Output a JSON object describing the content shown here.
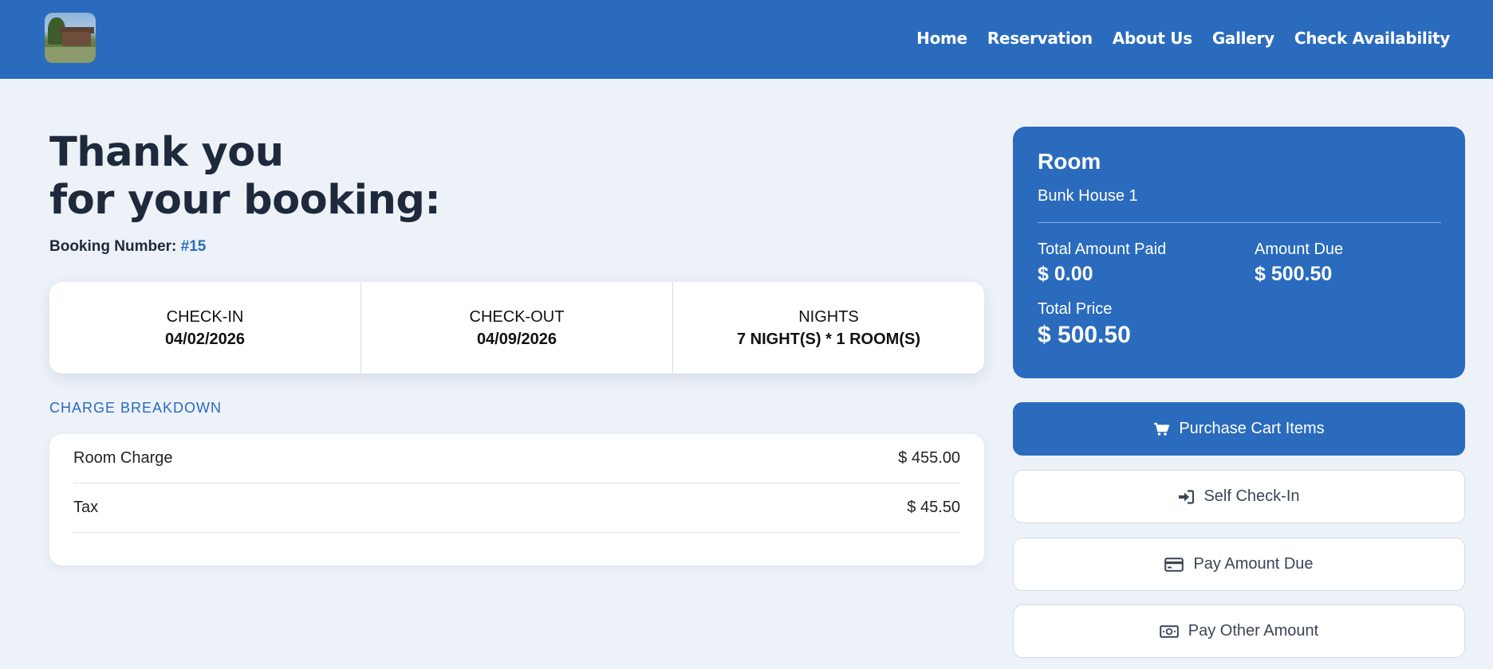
{
  "header": {
    "nav": [
      "Home",
      "Reservation",
      "About Us",
      "Gallery",
      "Check Availability"
    ]
  },
  "main": {
    "title_line1": "Thank you",
    "title_line2": "for your booking:",
    "booking_label": "Booking Number:",
    "booking_number": "#15",
    "stay": {
      "checkin_label": "CHECK-IN",
      "checkin_value": "04/02/2026",
      "checkout_label": "CHECK-OUT",
      "checkout_value": "04/09/2026",
      "nights_label": "NIGHTS",
      "nights_value": "7 NIGHT(S) * 1 ROOM(S)"
    },
    "breakdown_title": "CHARGE BREAKDOWN",
    "charges": [
      {
        "label": "Room Charge",
        "amount": "$ 455.00"
      },
      {
        "label": "Tax",
        "amount": "$ 45.50"
      }
    ]
  },
  "summary": {
    "room_title": "Room",
    "room_name": "Bunk House 1",
    "paid_label": "Total Amount Paid",
    "paid_value": "$ 0.00",
    "due_label": "Amount Due",
    "due_value": "$ 500.50",
    "total_label": "Total Price",
    "total_value": "$ 500.50"
  },
  "actions": {
    "purchase": "Purchase Cart Items",
    "self_checkin": "Self Check-In",
    "pay_due": "Pay Amount Due",
    "pay_other": "Pay Other Amount"
  },
  "icons": {
    "purchase": "cart-icon",
    "self_checkin": "sign-in-icon",
    "pay_due": "credit-card-icon",
    "pay_other": "money-bill-icon"
  },
  "colors": {
    "brand": "#2a6bbd",
    "background": "#edf1f8"
  }
}
